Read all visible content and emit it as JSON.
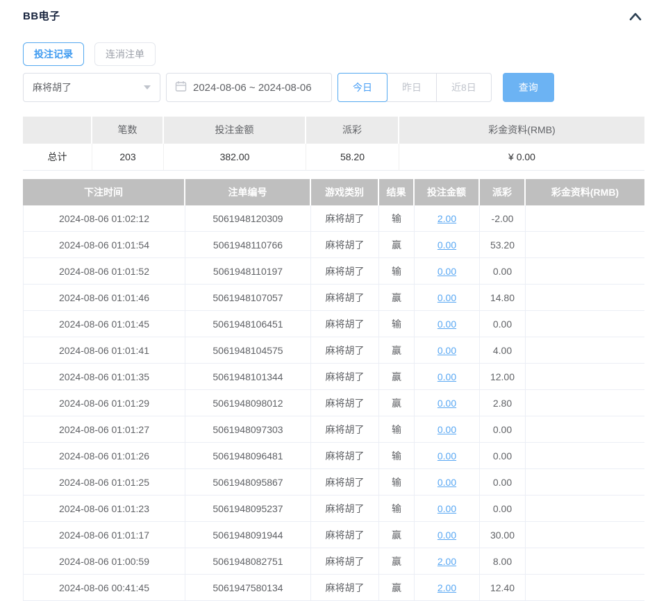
{
  "panel": {
    "title": "BB电子",
    "collapse_icon": "chevron-up"
  },
  "tabs": [
    {
      "label": "投注记录",
      "active": true
    },
    {
      "label": "连消注单",
      "active": false
    }
  ],
  "filters": {
    "game_select": {
      "value": "麻将胡了"
    },
    "date_range": {
      "value": "2024-08-06 ~ 2024-08-06"
    },
    "quick_buttons": [
      {
        "label": "今日",
        "active": true
      },
      {
        "label": "昨日",
        "active": false
      },
      {
        "label": "近8日",
        "active": false
      }
    ],
    "search_label": "查询"
  },
  "summary": {
    "headers": [
      "",
      "笔数",
      "投注金额",
      "派彩",
      "彩金资料(RMB)"
    ],
    "row": {
      "label": "总计",
      "count": "203",
      "bet_amount": "382.00",
      "payout": "58.20",
      "bonus": "¥ 0.00"
    }
  },
  "table": {
    "headers": [
      "下注时间",
      "注单编号",
      "游戏类别",
      "结果",
      "投注金额",
      "派彩",
      "彩金资料(RMB)"
    ],
    "rows": [
      {
        "time": "2024-08-06 01:02:12",
        "order": "5061948120309",
        "game": "麻将胡了",
        "result": "输",
        "bet": "2.00",
        "payout": "-2.00",
        "bonus": ""
      },
      {
        "time": "2024-08-06 01:01:54",
        "order": "5061948110766",
        "game": "麻将胡了",
        "result": "赢",
        "bet": "0.00",
        "payout": "53.20",
        "bonus": ""
      },
      {
        "time": "2024-08-06 01:01:52",
        "order": "5061948110197",
        "game": "麻将胡了",
        "result": "输",
        "bet": "0.00",
        "payout": "0.00",
        "bonus": ""
      },
      {
        "time": "2024-08-06 01:01:46",
        "order": "5061948107057",
        "game": "麻将胡了",
        "result": "赢",
        "bet": "0.00",
        "payout": "14.80",
        "bonus": ""
      },
      {
        "time": "2024-08-06 01:01:45",
        "order": "5061948106451",
        "game": "麻将胡了",
        "result": "输",
        "bet": "0.00",
        "payout": "0.00",
        "bonus": ""
      },
      {
        "time": "2024-08-06 01:01:41",
        "order": "5061948104575",
        "game": "麻将胡了",
        "result": "赢",
        "bet": "0.00",
        "payout": "4.00",
        "bonus": ""
      },
      {
        "time": "2024-08-06 01:01:35",
        "order": "5061948101344",
        "game": "麻将胡了",
        "result": "赢",
        "bet": "0.00",
        "payout": "12.00",
        "bonus": ""
      },
      {
        "time": "2024-08-06 01:01:29",
        "order": "5061948098012",
        "game": "麻将胡了",
        "result": "赢",
        "bet": "0.00",
        "payout": "2.80",
        "bonus": ""
      },
      {
        "time": "2024-08-06 01:01:27",
        "order": "5061948097303",
        "game": "麻将胡了",
        "result": "输",
        "bet": "0.00",
        "payout": "0.00",
        "bonus": ""
      },
      {
        "time": "2024-08-06 01:01:26",
        "order": "5061948096481",
        "game": "麻将胡了",
        "result": "输",
        "bet": "0.00",
        "payout": "0.00",
        "bonus": ""
      },
      {
        "time": "2024-08-06 01:01:25",
        "order": "5061948095867",
        "game": "麻将胡了",
        "result": "输",
        "bet": "0.00",
        "payout": "0.00",
        "bonus": ""
      },
      {
        "time": "2024-08-06 01:01:23",
        "order": "5061948095237",
        "game": "麻将胡了",
        "result": "输",
        "bet": "0.00",
        "payout": "0.00",
        "bonus": ""
      },
      {
        "time": "2024-08-06 01:01:17",
        "order": "5061948091944",
        "game": "麻将胡了",
        "result": "赢",
        "bet": "0.00",
        "payout": "30.00",
        "bonus": ""
      },
      {
        "time": "2024-08-06 01:00:59",
        "order": "5061948082751",
        "game": "麻将胡了",
        "result": "赢",
        "bet": "2.00",
        "payout": "8.00",
        "bonus": ""
      },
      {
        "time": "2024-08-06 00:41:45",
        "order": "5061947580134",
        "game": "麻将胡了",
        "result": "赢",
        "bet": "2.00",
        "payout": "12.40",
        "bonus": ""
      }
    ]
  },
  "colors": {
    "accent": "#53a8f0",
    "accent_fill": "#6cb3f3",
    "negative": "#f56c6c",
    "table_header_bg": "#bfbfbf"
  }
}
